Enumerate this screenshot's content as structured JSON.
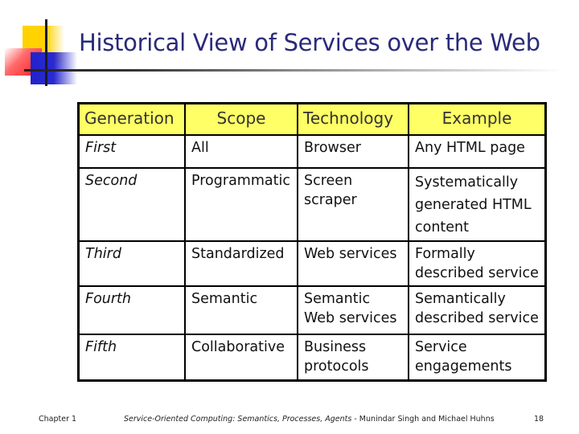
{
  "slide": {
    "title": "Historical View of Services over the Web",
    "table": {
      "headers": [
        "Generation",
        "Scope",
        "Technology",
        "Example"
      ],
      "rows": [
        [
          "First",
          "All",
          "Browser",
          "Any HTML page"
        ],
        [
          "Second",
          "Programmatic",
          "Screen scraper",
          "Systematically generated HTML content"
        ],
        [
          "Third",
          "Standardized",
          "Web services",
          "Formally described service"
        ],
        [
          "Fourth",
          "Semantic",
          "Semantic Web services",
          "Semantically described service"
        ],
        [
          "Fifth",
          "Collaborative",
          "Business protocols",
          "Service engagements"
        ]
      ]
    },
    "colors": {
      "title": "#2a2a7a",
      "header_bg": "#ffff66"
    }
  },
  "footer": {
    "chapter": "Chapter 1",
    "book_title": "Service-Oriented Computing: Semantics, Processes, Agents",
    "authors": " - Munindar Singh and Michael Huhns",
    "page": "18"
  }
}
